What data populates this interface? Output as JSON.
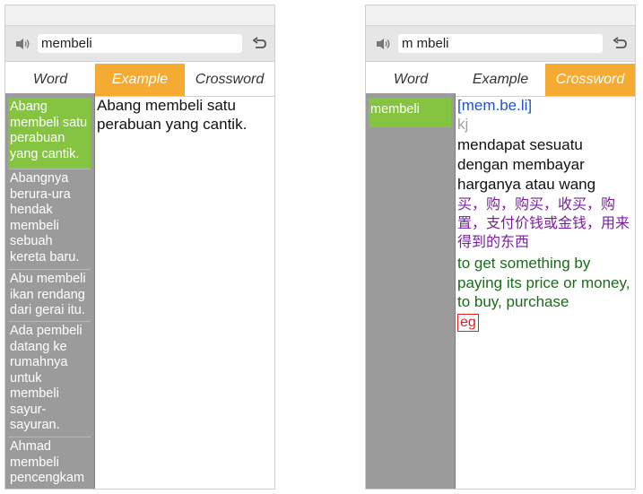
{
  "left": {
    "search": {
      "value": "membeli"
    },
    "tabs": [
      {
        "label": "Word",
        "active": false
      },
      {
        "label": "Example",
        "active": true
      },
      {
        "label": "Crossword",
        "active": false
      }
    ],
    "list": [
      "Abang membeli satu perabuan yang cantik.",
      "Abangnya berura-ura hendak membeli sebuah kereta baru.",
      "Abu membeli ikan rendang dari gerai itu.",
      "Ada pembeli datang ke rumahnya untuk membeli sayur-sayuran.",
      "Ahmad membeli pencengkam"
    ],
    "example_text": "Abang membeli satu perabuan yang cantik."
  },
  "right": {
    "search": {
      "value": "m mbeli"
    },
    "tabs": [
      {
        "label": "Word",
        "active": false
      },
      {
        "label": "Example",
        "active": false
      },
      {
        "label": "Crossword",
        "active": true
      }
    ],
    "list": [
      "membeli"
    ],
    "entry": {
      "phonetic": "[mem.be.li]",
      "word_class": "kj",
      "definition_ms": "mendapat sesuatu dengan membayar harganya atau wang",
      "definition_zh": "买，购，购买，收买，购置，支付价钱或金钱，用来得到的东西",
      "definition_en": "to get something by paying its price or money, to buy, purchase",
      "example_badge": "eg"
    }
  },
  "colors": {
    "active_tab": "#f5ab32",
    "selected_item": "#84c441",
    "list_bg": "#9b9b9b",
    "phonetic": "#1f55c9",
    "chinese": "#7a1fa2",
    "english": "#1b6b1b",
    "eg_badge": "#e21d1d"
  },
  "icons": {
    "speaker": "speaker-icon",
    "undo": "undo-icon"
  }
}
